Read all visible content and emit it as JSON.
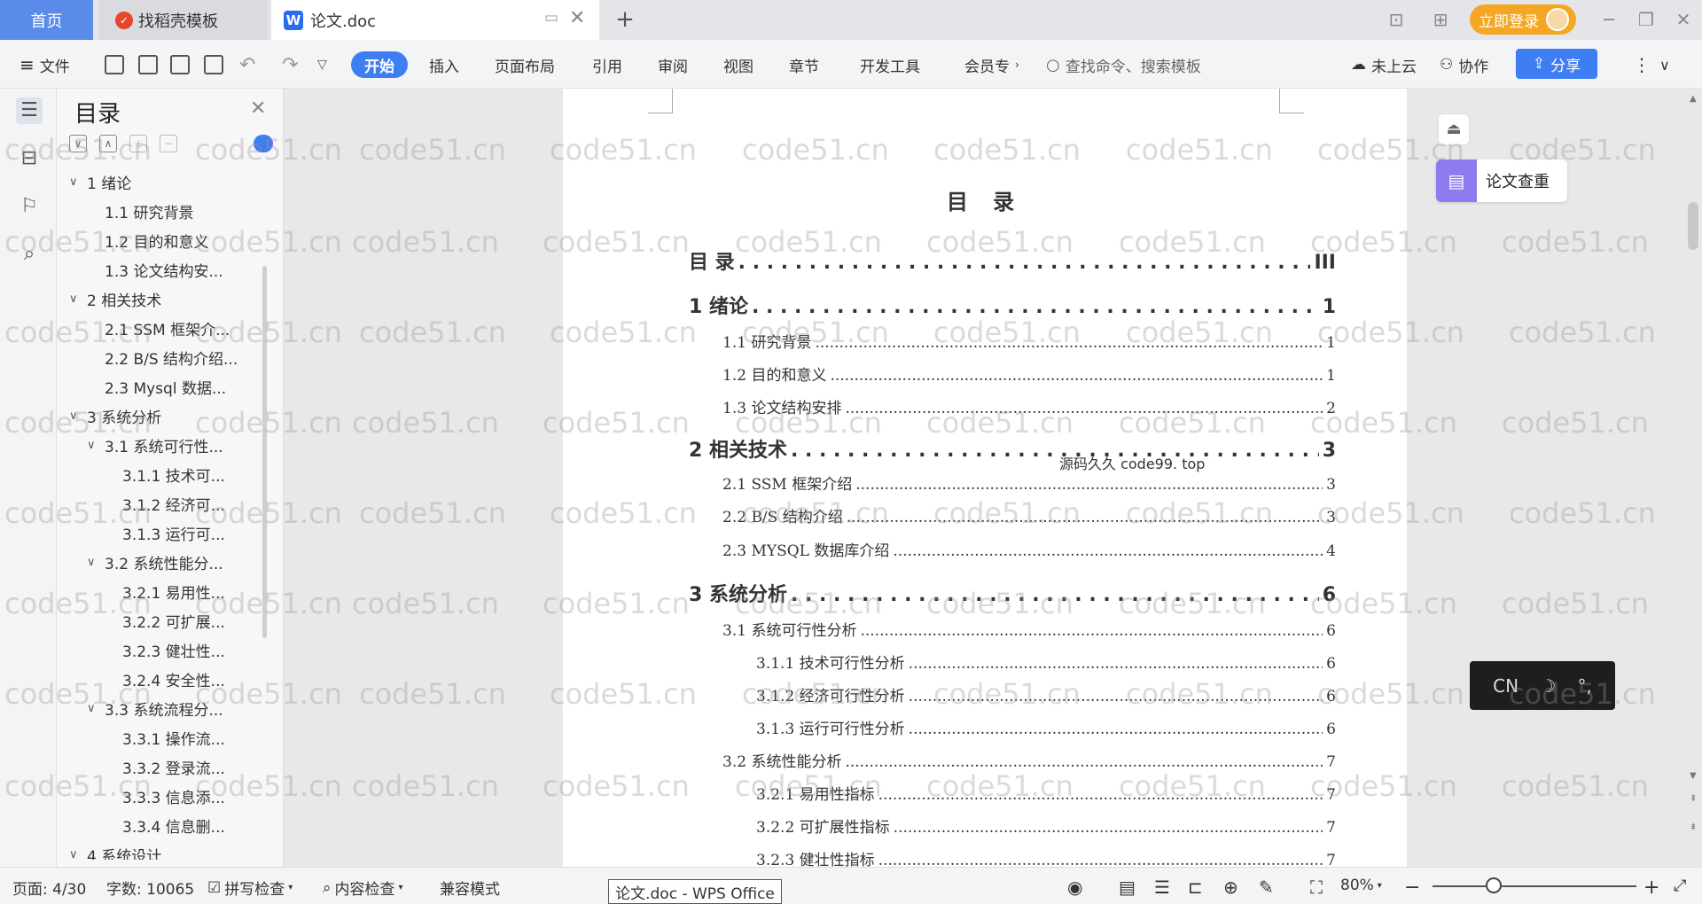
{
  "tabs": {
    "home": "首页",
    "template": "找稻壳模板",
    "doc": "论文.doc"
  },
  "login": "立即登录",
  "ribbon": {
    "file": "文件",
    "tabs": [
      "开始",
      "插入",
      "页面布局",
      "引用",
      "审阅",
      "视图",
      "章节",
      "开发工具",
      "会员专"
    ],
    "search_placeholder": "查找命令、搜索模板",
    "cloud": "未上云",
    "collab": "协作",
    "share": "分享"
  },
  "nav": {
    "title": "目录",
    "items": [
      {
        "label": "1  绪论",
        "level": 1,
        "caret": true
      },
      {
        "label": "1.1  研究背景",
        "level": 2
      },
      {
        "label": "1.2  目的和意义",
        "level": 2
      },
      {
        "label": "1.3  论文结构安...",
        "level": 2
      },
      {
        "label": "2  相关技术",
        "level": 1,
        "caret": true
      },
      {
        "label": "2.1 SSM 框架介...",
        "level": 2
      },
      {
        "label": "2.2 B/S 结构介绍...",
        "level": 2
      },
      {
        "label": "2.3 Mysql 数据...",
        "level": 2
      },
      {
        "label": "3  系统分析",
        "level": 1,
        "caret": true
      },
      {
        "label": "3.1  系统可行性...",
        "level": 2,
        "caret": true
      },
      {
        "label": "3.1.1  技术可...",
        "level": 3
      },
      {
        "label": "3.1.2  经济可...",
        "level": 3
      },
      {
        "label": "3.1.3  运行可...",
        "level": 3
      },
      {
        "label": "3.2  系统性能分...",
        "level": 2,
        "caret": true
      },
      {
        "label": "3.2.1  易用性...",
        "level": 3
      },
      {
        "label": "3.2.2  可扩展...",
        "level": 3
      },
      {
        "label": "3.2.3  健壮性...",
        "level": 3
      },
      {
        "label": "3.2.4  安全性...",
        "level": 3
      },
      {
        "label": "3.3  系统流程分...",
        "level": 2,
        "caret": true
      },
      {
        "label": "3.3.1  操作流...",
        "level": 3
      },
      {
        "label": "3.3.2  登录流...",
        "level": 3
      },
      {
        "label": "3.3.3  信息添...",
        "level": 3
      },
      {
        "label": "3.3.4  信息删...",
        "level": 3
      },
      {
        "label": "4  系统设计",
        "level": 1,
        "caret": true
      }
    ]
  },
  "document": {
    "title": "目  录",
    "toc": [
      {
        "label": "目  录",
        "page": "III",
        "style": "lvl1",
        "indent": 0
      },
      {
        "label": "1  绪论",
        "page": "1",
        "style": "lvl1",
        "indent": 0
      },
      {
        "label": "1.1  研究背景",
        "page": "1",
        "style": "lvl2",
        "indent": 1
      },
      {
        "label": "1.2  目的和意义",
        "page": "1",
        "style": "lvl2",
        "indent": 1
      },
      {
        "label": "1.3  论文结构安排",
        "page": "2",
        "style": "lvl2",
        "indent": 1
      },
      {
        "label": "2  相关技术",
        "page": "3",
        "style": "lvl1",
        "indent": 0
      },
      {
        "label": "2.1 SSM 框架介绍",
        "page": "3",
        "style": "lvl2",
        "indent": 1
      },
      {
        "label": "2.2 B/S 结构介绍",
        "page": "3",
        "style": "lvl2",
        "indent": 1
      },
      {
        "label": "2.3 MYSQL 数据库介绍",
        "page": "4",
        "style": "lvl2",
        "indent": 1
      },
      {
        "label": "3  系统分析",
        "page": "6",
        "style": "lvl1",
        "indent": 0
      },
      {
        "label": "3.1  系统可行性分析",
        "page": "6",
        "style": "lvl2",
        "indent": 1
      },
      {
        "label": "3.1.1  技术可行性分析",
        "page": "6",
        "style": "lvl2",
        "indent": 2
      },
      {
        "label": "3.1.2  经济可行性分析",
        "page": "6",
        "style": "lvl2",
        "indent": 2
      },
      {
        "label": "3.1.3  运行可行性分析",
        "page": "6",
        "style": "lvl2",
        "indent": 2
      },
      {
        "label": "3.2  系统性能分析",
        "page": "7",
        "style": "lvl2",
        "indent": 1
      },
      {
        "label": "3.2.1  易用性指标",
        "page": "7",
        "style": "lvl2",
        "indent": 2
      },
      {
        "label": "3.2.2  可扩展性指标",
        "page": "7",
        "style": "lvl2",
        "indent": 2
      },
      {
        "label": "3.2.3  健壮性指标",
        "page": "7",
        "style": "lvl2",
        "indent": 2
      }
    ],
    "source_mark": "源码久久 code99. top"
  },
  "right": {
    "check": "论文查重"
  },
  "ime": {
    "lang": "CN"
  },
  "status": {
    "page": "页面: 4/30",
    "words": "字数: 10065",
    "spell": "拼写检查",
    "content": "内容检查",
    "compat": "兼容模式",
    "tooltip": "论文.doc - WPS Office",
    "zoom": "80%",
    "zoom_level": 0.3
  },
  "watermark": "code51.cn",
  "colors": {
    "accent": "#3f7df2",
    "login": "#f5a623",
    "check": "#8c7cf0"
  }
}
